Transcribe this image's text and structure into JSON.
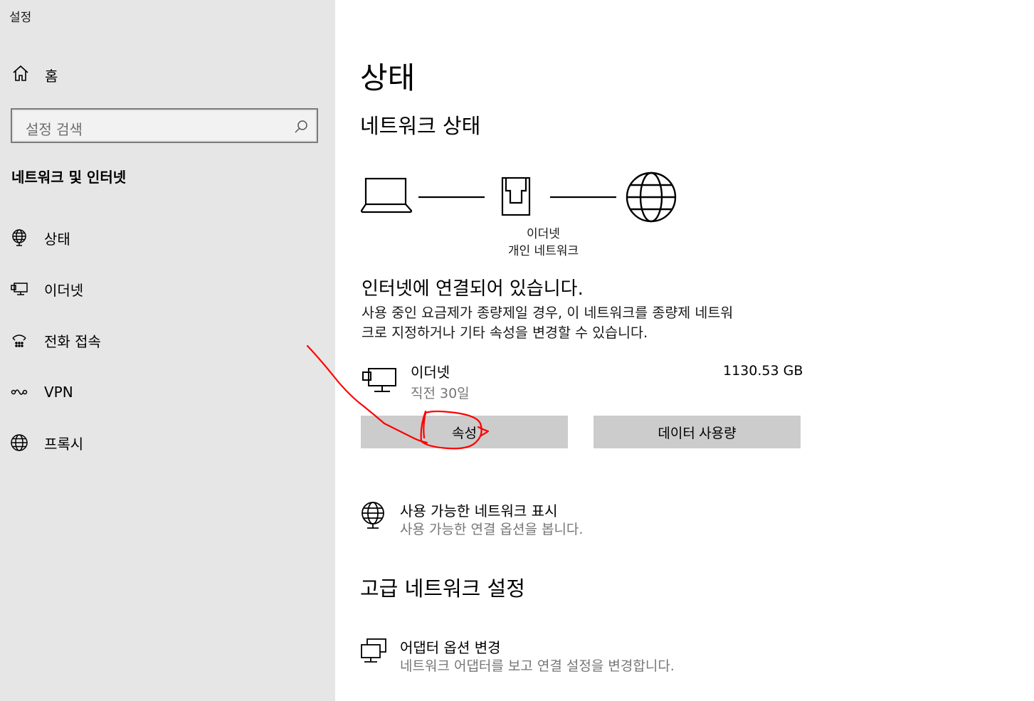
{
  "window": {
    "title": "설정"
  },
  "sidebar": {
    "home_label": "홈",
    "search_placeholder": "설정 검색",
    "section_title": "네트워크 및 인터넷",
    "items": [
      {
        "label": "상태",
        "icon": "globe-status-icon"
      },
      {
        "label": "이더넷",
        "icon": "ethernet-icon"
      },
      {
        "label": "전화 접속",
        "icon": "dial-up-icon"
      },
      {
        "label": "VPN",
        "icon": "vpn-icon"
      },
      {
        "label": "프록시",
        "icon": "globe-icon"
      }
    ]
  },
  "main": {
    "page_title": "상태",
    "network_status_title": "네트워크 상태",
    "diagram": {
      "connection_label": "이더넷",
      "network_label": "개인 네트워크",
      "icons": [
        "laptop-icon",
        "ethernet-port-icon",
        "globe-icon"
      ]
    },
    "connected_text": "인터넷에 연결되어 있습니다.",
    "description_line1": "사용 중인 요금제가 종량제일 경우, 이 네트워크를 종량제 네트워",
    "description_line2": "크로 지정하거나 기타 속성을 변경할 수 있습니다.",
    "connection": {
      "name": "이더넷",
      "time": "직전 30일",
      "usage": "1130.53 GB"
    },
    "buttons": {
      "properties": "속성",
      "data_usage": "데이터 사용량"
    },
    "show_networks": {
      "title": "사용 가능한 네트워크 표시",
      "subtitle": "사용 가능한 연결 옵션을 봅니다."
    },
    "advanced_title": "고급 네트워크 설정",
    "adapter_options": {
      "title": "어댑터 옵션 변경",
      "subtitle": "네트워크 어댑터를 보고 연결 설정을 변경합니다."
    }
  },
  "annotation": {
    "color": "#ff0000",
    "shape": "hand-drawn-arrow-circle"
  }
}
